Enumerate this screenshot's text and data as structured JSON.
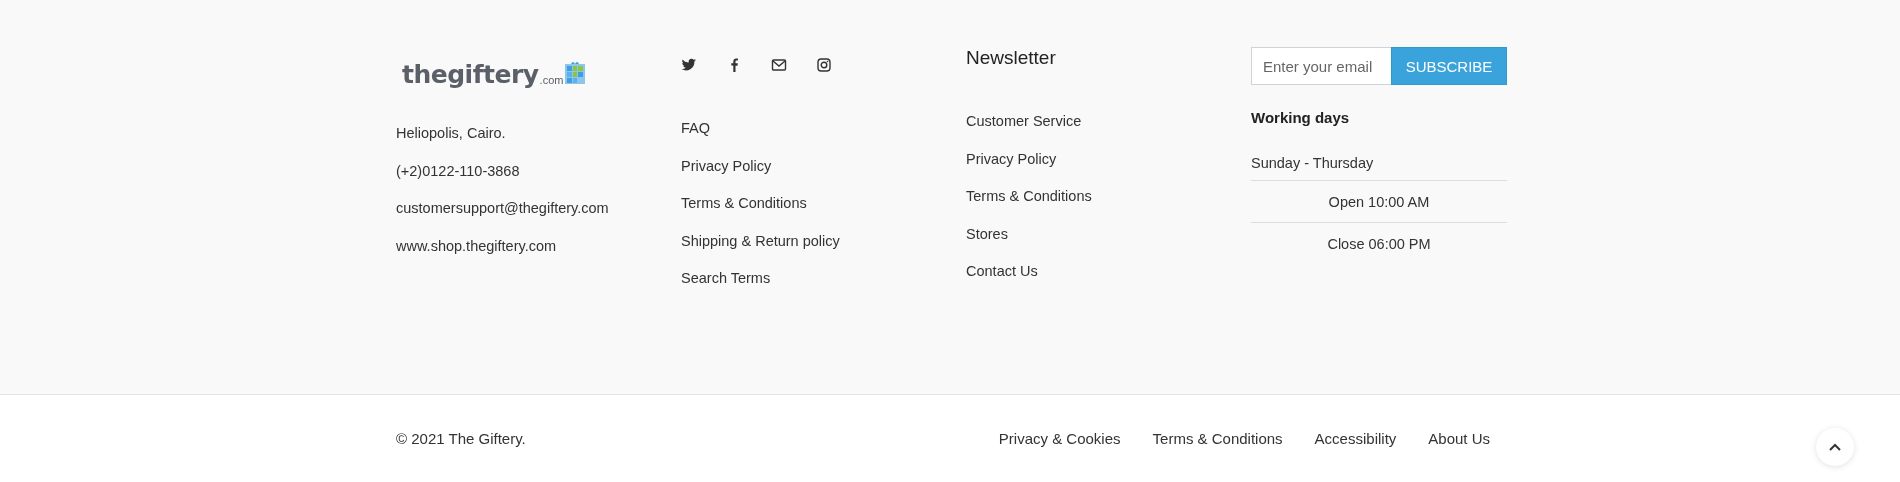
{
  "logo": {
    "name": "thegiftery",
    "suffix": ".com"
  },
  "contact": [
    "Heliopolis, Cairo.",
    "(+2)0122-110-3868",
    "customersupport@thegiftery.com",
    "www.shop.thegiftery.com"
  ],
  "social": [
    {
      "kind": "twitter"
    },
    {
      "kind": "facebook"
    },
    {
      "kind": "mail"
    },
    {
      "kind": "instagram"
    }
  ],
  "links": [
    "FAQ",
    "Privacy Policy",
    "Terms & Conditions",
    "Shipping & Return policy",
    "Search Terms"
  ],
  "newsletter": {
    "title": "Newsletter",
    "links": [
      "Customer Service",
      "Privacy Policy",
      "Terms & Conditions",
      "Stores",
      "Contact Us"
    ]
  },
  "subscribe": {
    "placeholder": "Enter your email",
    "button": "SUBSCRIBE"
  },
  "working_days": {
    "title": "Working days",
    "days": "Sunday - Thursday",
    "hours": [
      "Open 10:00 AM",
      "Close 06:00 PM"
    ]
  },
  "bottom": {
    "copyright": "© 2021 The Giftery.",
    "links": [
      "Privacy & Cookies",
      "Terms & Conditions",
      "Accessibility",
      "About Us"
    ]
  }
}
